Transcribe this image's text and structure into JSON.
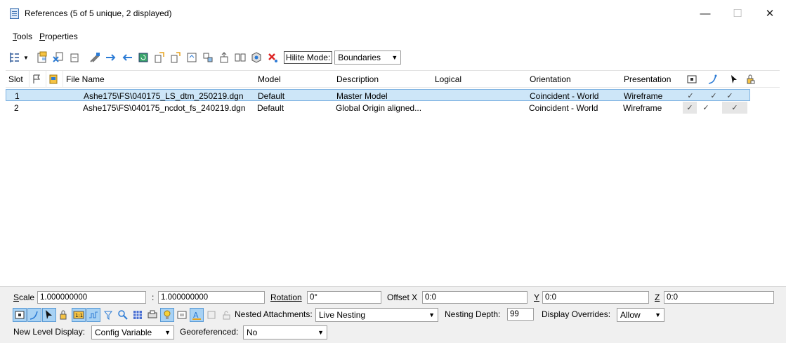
{
  "window": {
    "title": "References (5 of 5 unique, 2 displayed)",
    "minimize": "—",
    "maximize": "☐",
    "close": "✕"
  },
  "menu": {
    "tools": "Tools",
    "tools_key": "T",
    "tools_rest": "ools",
    "properties": "Properties",
    "properties_key": "P",
    "properties_rest": "roperties"
  },
  "toolbar": {
    "hilite_label": "Hilite Mode:",
    "hilite_value": "Boundaries",
    "icons": [
      "tree-view-icon",
      "attach-reference-icon",
      "detach-reference-icon",
      "reload-reference-icon",
      "copy-attachment-icon",
      "move-reference-icon",
      "mirror-reference-icon",
      "rotate-reference-icon",
      "scale-reference-icon",
      "clip-boundary-icon",
      "clip-mask-icon",
      "clip-front-icon",
      "clip-back-icon",
      "delete-clip-icon",
      "3d-view-icon",
      "exchange-icon",
      "no-icon"
    ]
  },
  "table": {
    "columns": [
      "Slot",
      "",
      "",
      "File Name",
      "Model",
      "Description",
      "Logical",
      "Orientation",
      "Presentation",
      "",
      "",
      "",
      ""
    ],
    "column_icons": [
      "flag-icon",
      "file-icon",
      "display-icon",
      "snap-icon",
      "locate-icon",
      "lock-icon"
    ],
    "rows": [
      {
        "slot": "1",
        "file": "Ashe175\\FS\\040175_LS_dtm_250219.dgn",
        "model": "Default",
        "description": "Master Model",
        "logical": "",
        "orientation": "Coincident - World",
        "presentation": "Wireframe",
        "display": "✓",
        "snap": "✓",
        "locate": "✓",
        "selected": true
      },
      {
        "slot": "2",
        "file": "Ashe175\\FS\\040175_ncdot_fs_240219.dgn",
        "model": "Default",
        "description": "Global Origin aligned...",
        "logical": "",
        "orientation": "Coincident - World",
        "presentation": "Wireframe",
        "display": "✓",
        "snap": "✓",
        "locate": "✓",
        "selected": false
      }
    ]
  },
  "bottom": {
    "scale_label": "Scale",
    "scale_key": "S",
    "scale_rest": "cale",
    "scale_a": "1.000000000",
    "scale_sep": ":",
    "scale_b": "1.000000000",
    "rotation_label": "Rotation",
    "rotation_value": "0°",
    "offset_label": "Offset X",
    "offset_x": "0:0",
    "y_label": "Y",
    "y_value": "0:0",
    "z_label": "Z",
    "z_value": "0:0",
    "nested_label": "Nested Attachments:",
    "nested_value": "Live Nesting",
    "depth_label": "Nesting Depth:",
    "depth_value": "99",
    "overrides_label": "Display Overrides:",
    "overrides_value": "Allow",
    "newlevel_label": "New Level Display:",
    "newlevel_value": "Config Variable",
    "georef_label": "Georeferenced:",
    "georef_value": "No"
  }
}
